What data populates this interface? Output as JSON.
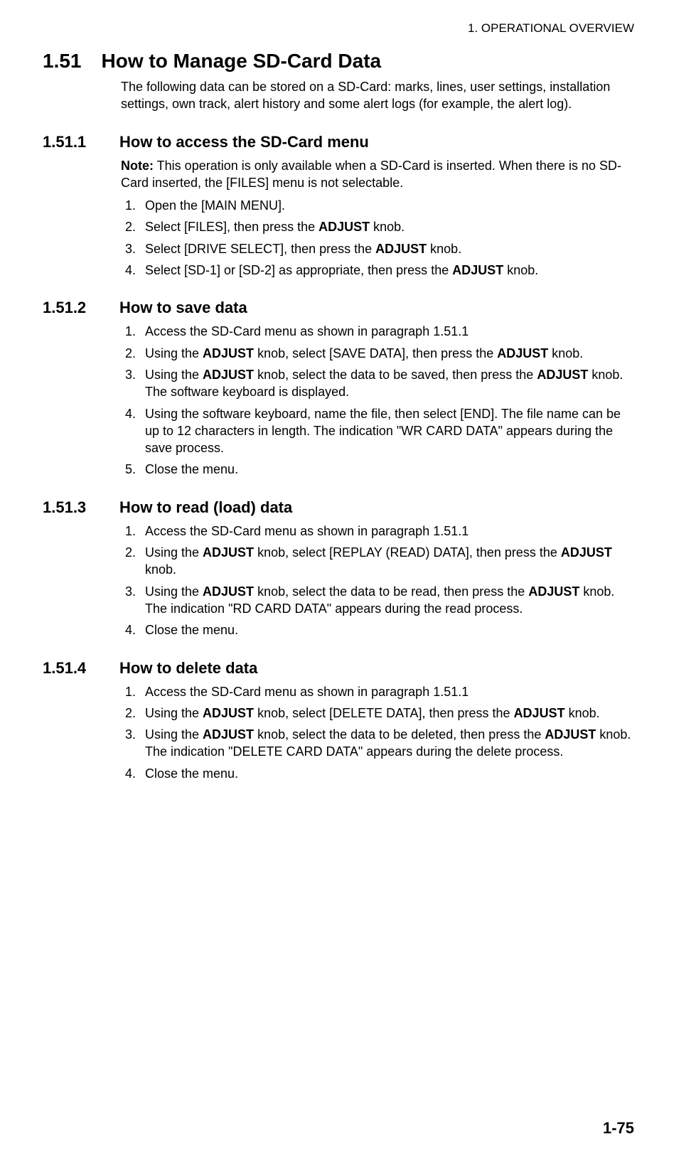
{
  "header": "1.  OPERATIONAL OVERVIEW",
  "section": {
    "num": "1.51",
    "title": "How to Manage SD-Card Data",
    "intro": "The following data can be stored on a SD-Card: marks, lines, user settings, installation settings, own track, alert history and some alert logs (for example, the alert log)."
  },
  "sub1": {
    "num": "1.51.1",
    "title": "How to access the SD-Card menu",
    "note_label": "Note:",
    "note_text": " This operation is only available when a SD-Card is inserted. When there is no SD-Card inserted, the [FILES] menu is not selectable.",
    "steps": [
      "Open the [MAIN MENU].",
      "Select [FILES], then press the <strong>ADJUST</strong> knob.",
      "Select [DRIVE SELECT], then press the <strong>ADJUST</strong> knob.",
      "Select [SD-1] or [SD-2] as appropriate, then press the <strong>ADJUST</strong> knob."
    ]
  },
  "sub2": {
    "num": "1.51.2",
    "title": "How to save data",
    "steps": [
      "Access the SD-Card menu as shown in paragraph 1.51.1",
      "Using the <strong>ADJUST</strong> knob, select [SAVE DATA], then press the <strong>ADJUST</strong> knob.",
      "Using the <strong>ADJUST</strong> knob, select the data to be saved, then press the <strong>ADJUST</strong> knob. The software keyboard is displayed.",
      "Using the software keyboard, name the file, then select [END]. The file name can be up to 12 characters in length. The indication \"WR CARD DATA\" appears during the save process.",
      "Close the menu."
    ]
  },
  "sub3": {
    "num": "1.51.3",
    "title": "How to read (load) data",
    "steps": [
      "Access the SD-Card menu as shown in paragraph 1.51.1",
      "Using the <strong>ADJUST</strong> knob, select [REPLAY (READ) DATA], then press the <strong>ADJUST</strong> knob.",
      "Using the <strong>ADJUST</strong> knob, select the data to be read, then press the <strong>ADJUST</strong> knob. The indication \"RD CARD DATA\" appears during the read process.",
      "Close the menu."
    ]
  },
  "sub4": {
    "num": "1.51.4",
    "title": "How to delete data",
    "steps": [
      "Access the SD-Card menu as shown in paragraph 1.51.1",
      "Using the <strong>ADJUST</strong> knob, select [DELETE DATA], then press the <strong>ADJUST</strong> knob.",
      "Using the <strong>ADJUST</strong> knob, select the data to be deleted, then press the <strong>ADJUST</strong> knob. The indication \"DELETE CARD DATA\" appears during the delete process.",
      "Close the menu."
    ]
  },
  "page_number": "1-75"
}
